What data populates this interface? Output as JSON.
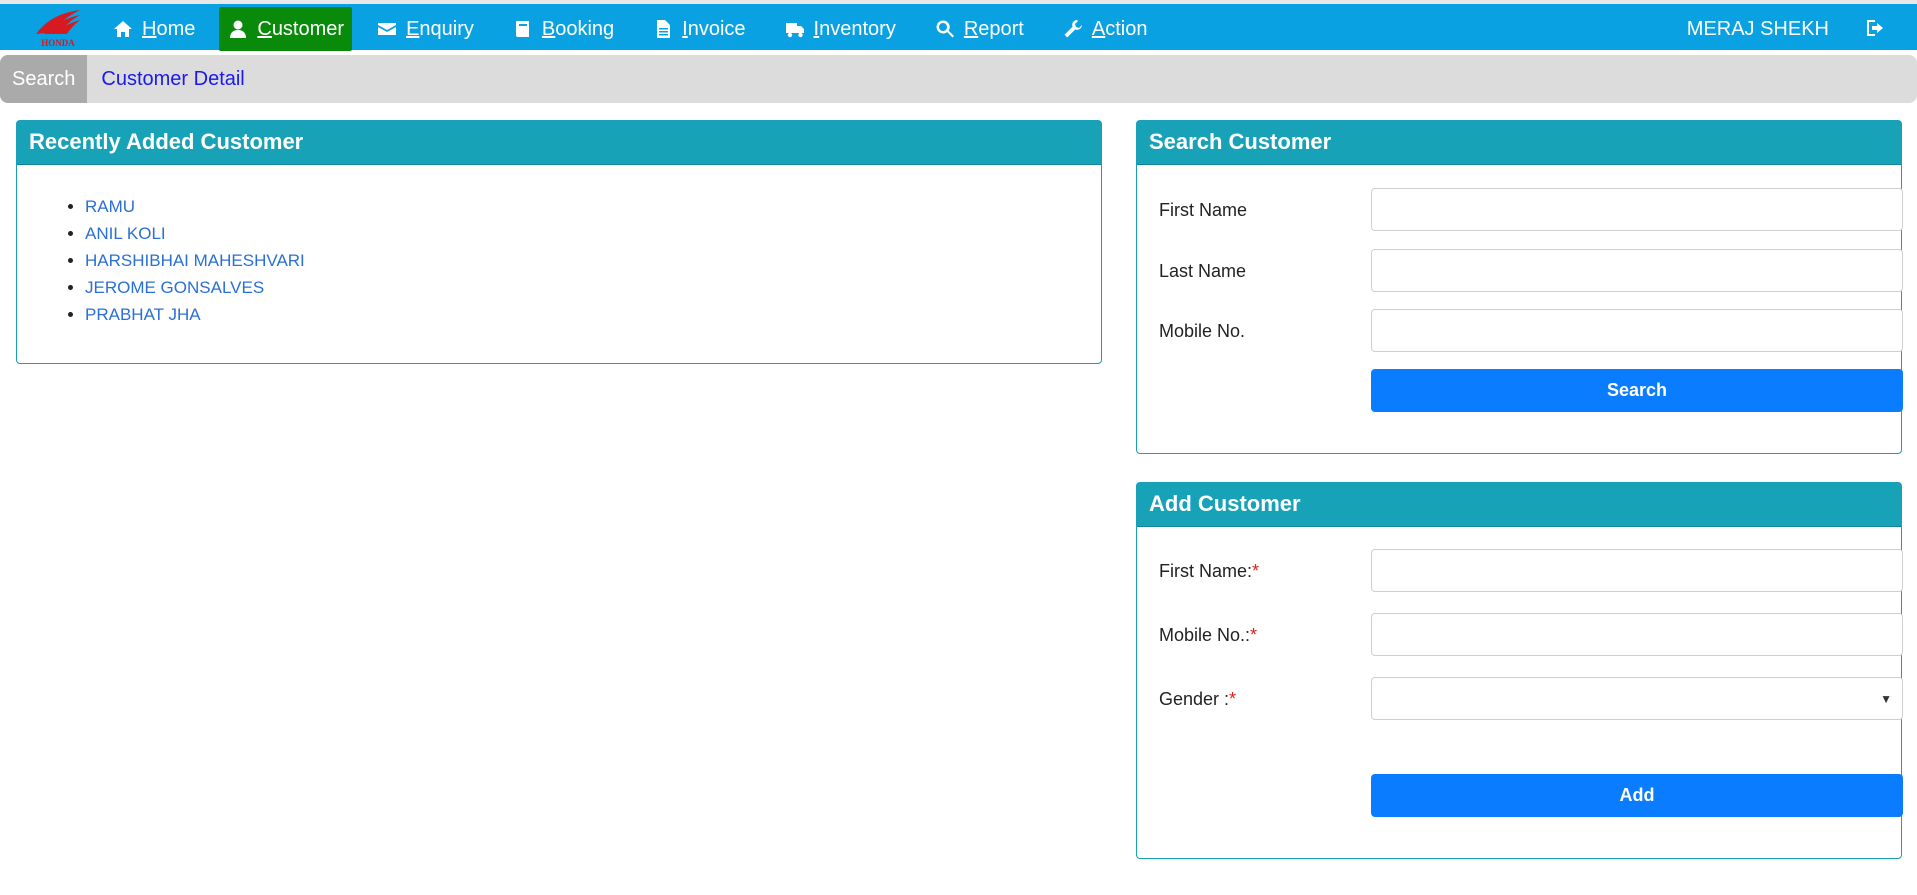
{
  "brand": {
    "logo_text": "HONDA",
    "color": "#d71920"
  },
  "nav": {
    "items": [
      {
        "label": "Home",
        "icon": "home-icon",
        "active": false
      },
      {
        "label": "Customer",
        "icon": "user-icon",
        "active": true
      },
      {
        "label": "Enquiry",
        "icon": "envelope-icon",
        "active": false
      },
      {
        "label": "Booking",
        "icon": "book-icon",
        "active": false
      },
      {
        "label": "Invoice",
        "icon": "document-icon",
        "active": false
      },
      {
        "label": "Inventory",
        "icon": "truck-icon",
        "active": false
      },
      {
        "label": "Report",
        "icon": "search-icon",
        "active": false
      },
      {
        "label": "Action",
        "icon": "wrench-icon",
        "active": false
      }
    ],
    "user_name": "MERAJ SHEKH",
    "logout_icon": "sign-out-icon"
  },
  "breadcrumb": {
    "search_label": "Search",
    "link_label": "Customer Detail"
  },
  "recent": {
    "title": "Recently Added Customer",
    "customers": [
      "RAMU",
      "ANIL KOLI",
      "HARSHIBHAI MAHESHVARI",
      "JEROME GONSALVES",
      "PRABHAT JHA"
    ]
  },
  "search": {
    "title": "Search Customer",
    "first_name_label": "First Name",
    "last_name_label": "Last Name",
    "mobile_label": "Mobile No.",
    "first_name_value": "",
    "last_name_value": "",
    "mobile_value": "",
    "button_label": "Search"
  },
  "add": {
    "title": "Add Customer",
    "first_name_label": "First Name:",
    "mobile_label": "Mobile No.:",
    "gender_label": "Gender :",
    "required_mark": "*",
    "first_name_value": "",
    "mobile_value": "",
    "gender_value": "",
    "button_label": "Add"
  },
  "colors": {
    "nav_bg": "#0aa1e2",
    "active_bg": "#0a8a0a",
    "panel_head": "#17a2b8",
    "button": "#0a7cff",
    "link": "#2a6fd6"
  }
}
